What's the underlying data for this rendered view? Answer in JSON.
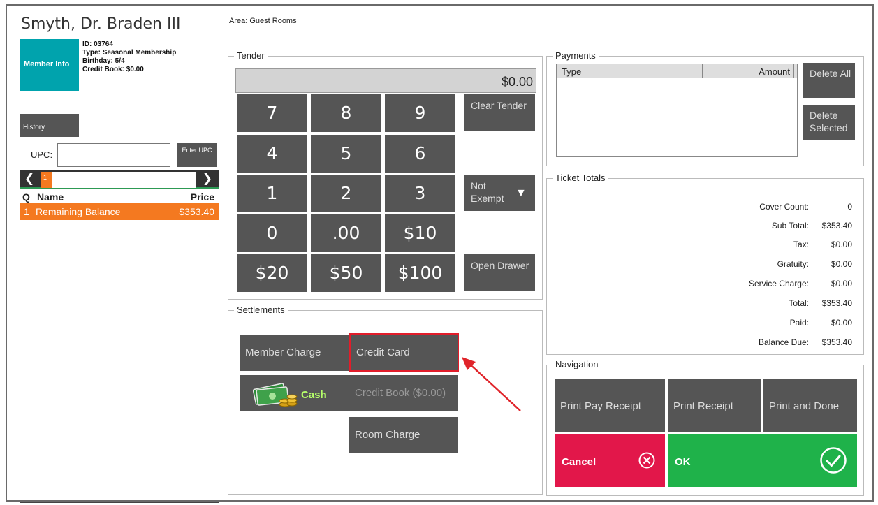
{
  "member": {
    "name": "Smyth, Dr.  Braden III",
    "tile_label": "Member Info",
    "id": "ID: 03764",
    "type": "Type: Seasonal Membership",
    "birthday": "Birthday: 5/4",
    "credit_book": "Credit Book: $0.00"
  },
  "history_label": "History",
  "upc": {
    "label": "UPC:",
    "value": "",
    "button_label": "Enter UPC"
  },
  "item_list": {
    "page_number": "1",
    "columns": {
      "q": "Q",
      "name": "Name",
      "price": "Price"
    },
    "rows": [
      {
        "q": "1",
        "name": "Remaining Balance",
        "price": "$353.40"
      }
    ]
  },
  "area_label": "Area: Guest Rooms",
  "tender": {
    "title": "Tender",
    "display": "$0.00",
    "keys": [
      "7",
      "8",
      "9",
      "4",
      "5",
      "6",
      "1",
      "2",
      "3",
      "0",
      ".00",
      "$10",
      "$20",
      "$50",
      "$100"
    ],
    "clear_label": "Clear Tender",
    "exempt_label": "Not Exempt",
    "drawer_label": "Open Drawer"
  },
  "settlements": {
    "title": "Settlements",
    "member_charge": "Member Charge",
    "credit_card": "Credit Card",
    "cash": "Cash",
    "credit_book": "Credit Book ($0.00)",
    "room_charge": "Room Charge"
  },
  "payments": {
    "title": "Payments",
    "col_type": "Type",
    "col_amount": "Amount",
    "delete_all": "Delete All",
    "delete_selected": "Delete Selected"
  },
  "ticket_totals": {
    "title": "Ticket Totals",
    "rows": [
      {
        "label": "Cover Count:",
        "value": "0"
      },
      {
        "label": "Sub Total:",
        "value": "$353.40"
      },
      {
        "label": "Tax:",
        "value": "$0.00"
      },
      {
        "label": "Gratuity:",
        "value": "$0.00"
      },
      {
        "label": "Service Charge:",
        "value": "$0.00"
      },
      {
        "label": "Total:",
        "value": "$353.40"
      },
      {
        "label": "Paid:",
        "value": "$0.00"
      },
      {
        "label": "Balance Due:",
        "value": "$353.40"
      }
    ]
  },
  "navigation": {
    "title": "Navigation",
    "print_pay_receipt": "Print Pay Receipt",
    "print_receipt": "Print Receipt",
    "print_and_done": "Print and Done",
    "cancel": "Cancel",
    "ok": "OK"
  },
  "colors": {
    "member_tile": "#00a3ad",
    "accent_orange": "#f47920",
    "button_gray": "#555555",
    "cancel_red": "#e2174a",
    "ok_green": "#1fb24a",
    "highlight_red": "#e21d2a"
  }
}
